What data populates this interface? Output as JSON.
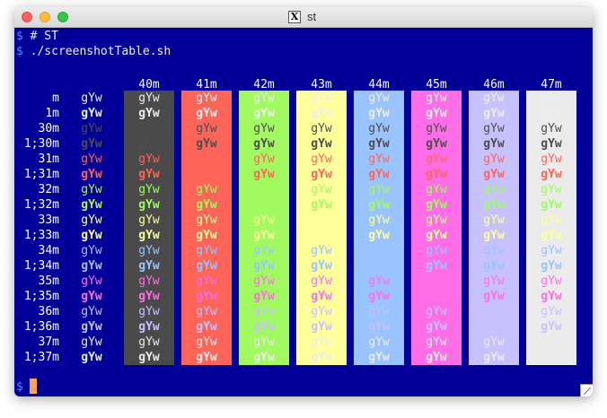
{
  "window": {
    "title": "st",
    "x_logo": "X",
    "traffic_lights": [
      "close",
      "minimize",
      "maximize"
    ]
  },
  "terminal": {
    "prompt_symbol": "$",
    "lines": [
      "# ST",
      "./screenshotTable.sh"
    ],
    "background": "#000099",
    "cursor_color": "#ffa54f"
  },
  "table": {
    "sample_text": "gYw",
    "columns": [
      "40m",
      "41m",
      "42m",
      "43m",
      "44m",
      "45m",
      "46m",
      "47m"
    ],
    "column_backgrounds": [
      "#4a4a4a",
      "#ff6459",
      "#a1fa5f",
      "#ffff9c",
      "#99c4ff",
      "#ff6ee6",
      "#c7c2ff",
      "#ebebeb"
    ],
    "rows": [
      "m",
      "1m",
      "30m",
      "1;30m",
      "31m",
      "1;31m",
      "32m",
      "1;32m",
      "33m",
      "1;33m",
      "34m",
      "1;34m",
      "35m",
      "1;35m",
      "36m",
      "1;36m",
      "37m",
      "1;37m"
    ],
    "foreground_colors": {
      "default": "#eeeeee",
      "black": "#4d4d4d",
      "red": "#ff6459",
      "green": "#a1fa5f",
      "yellow": "#ffff9c",
      "blue": "#99c4ff",
      "magenta": "#ff6ee6",
      "cyan": "#c7c2ff",
      "white": "#ebebeb"
    }
  }
}
